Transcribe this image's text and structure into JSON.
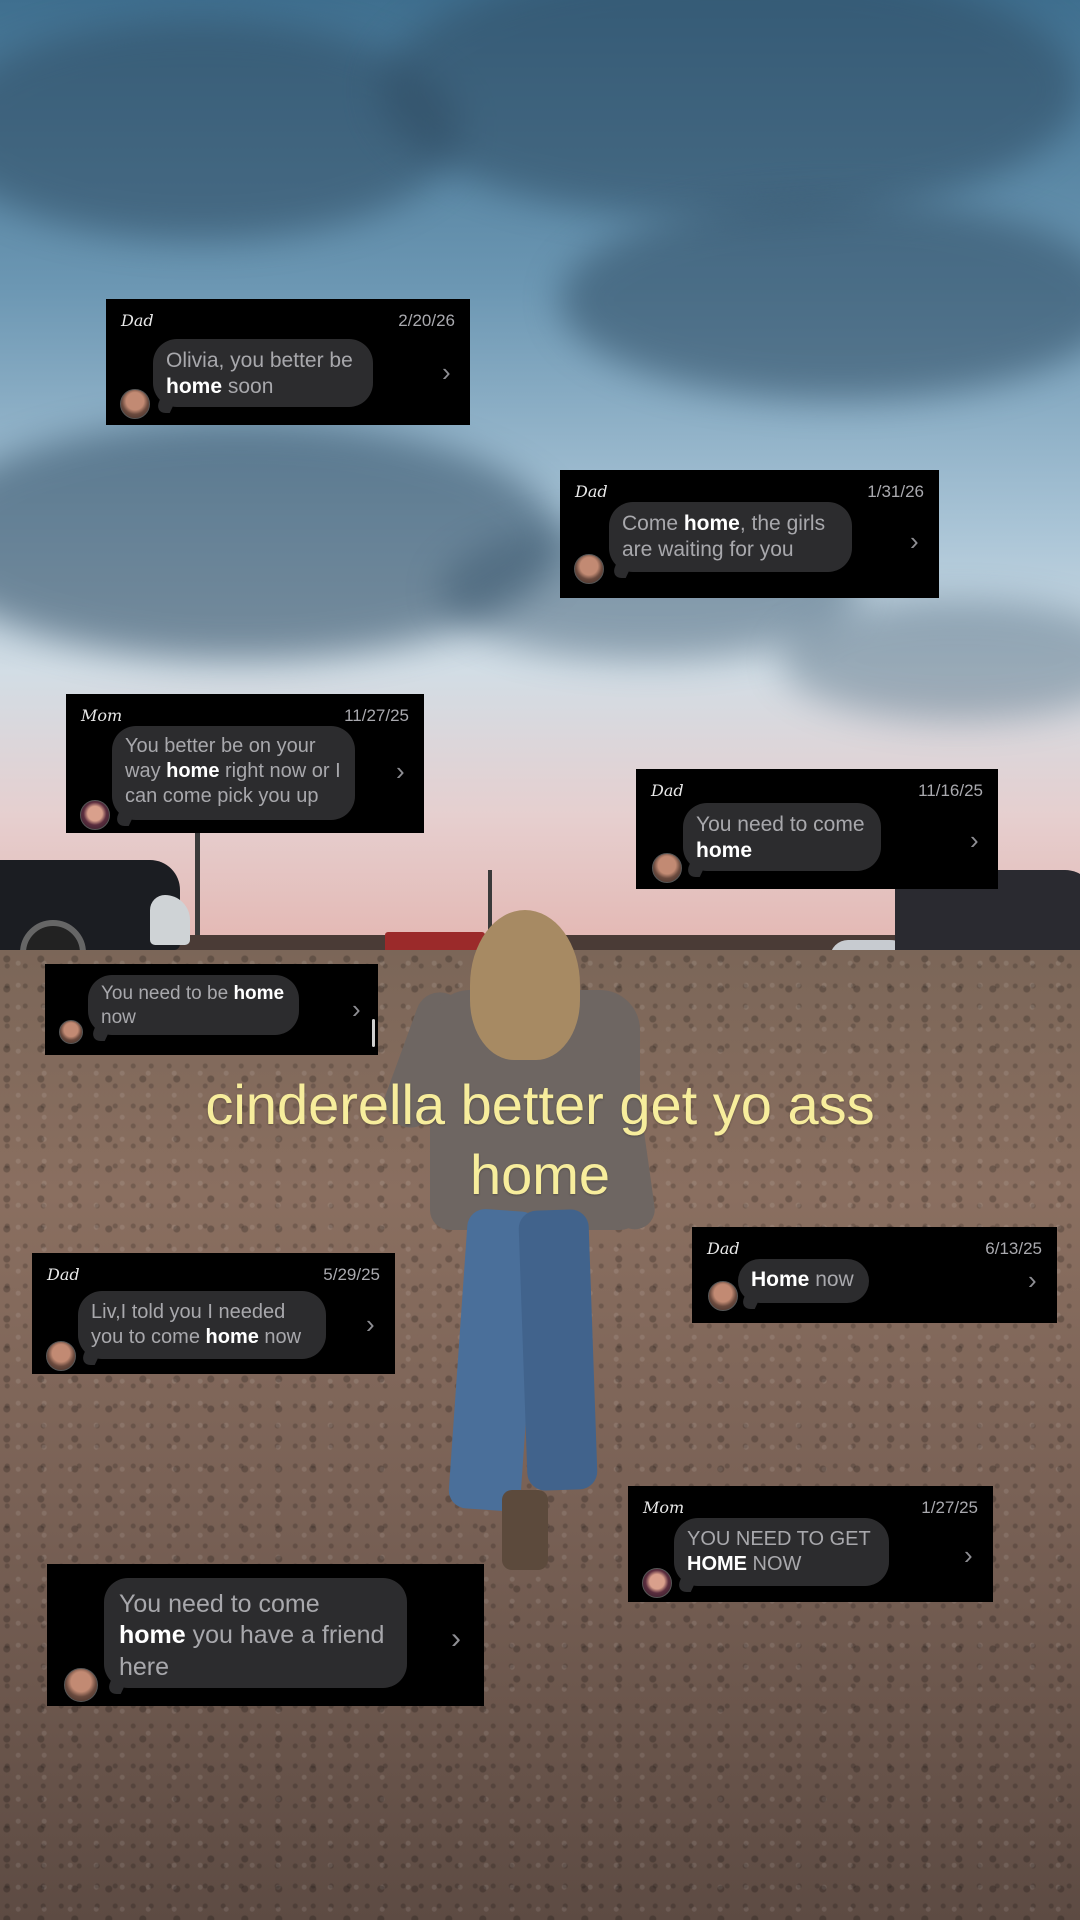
{
  "caption": "cinderella better get yo ass home",
  "messages": [
    {
      "sender": "Dad",
      "date": "2/20/26",
      "pre": "Olivia, you better be ",
      "bold": "home",
      "post": " soon"
    },
    {
      "sender": "Dad",
      "date": "1/31/26",
      "pre": "Come ",
      "bold": "home",
      "post": ", the girls are waiting for you"
    },
    {
      "sender": "Mom",
      "date": "11/27/25",
      "pre": "You better be on your way ",
      "bold": "home",
      "post": " right now or I can come pick you up"
    },
    {
      "sender": "Dad",
      "date": "11/16/25",
      "pre": "You need to come ",
      "bold": "home",
      "post": ""
    },
    {
      "sender": "",
      "date": "",
      "pre": "You need to be ",
      "bold": "home",
      "post": " now"
    },
    {
      "sender": "Dad",
      "date": "6/13/25",
      "pre": "",
      "bold": "Home",
      "post": " now"
    },
    {
      "sender": "Dad",
      "date": "5/29/25",
      "pre": "Liv,I told you I needed you to come ",
      "bold": "home",
      "post": " now"
    },
    {
      "sender": "Mom",
      "date": "1/27/25",
      "pre": "YOU NEED TO GET ",
      "bold": "HOME",
      "post": " NOW"
    },
    {
      "sender": "",
      "date": "",
      "pre": "You need to come ",
      "bold": "home",
      "post": " you have a friend here"
    }
  ],
  "icons": {
    "chevron": "chevron-right-icon",
    "avatar": "contact-avatar"
  },
  "colors": {
    "caption": "#f7ed9c",
    "card": "#000000",
    "bubble": "#2c2c2e"
  }
}
